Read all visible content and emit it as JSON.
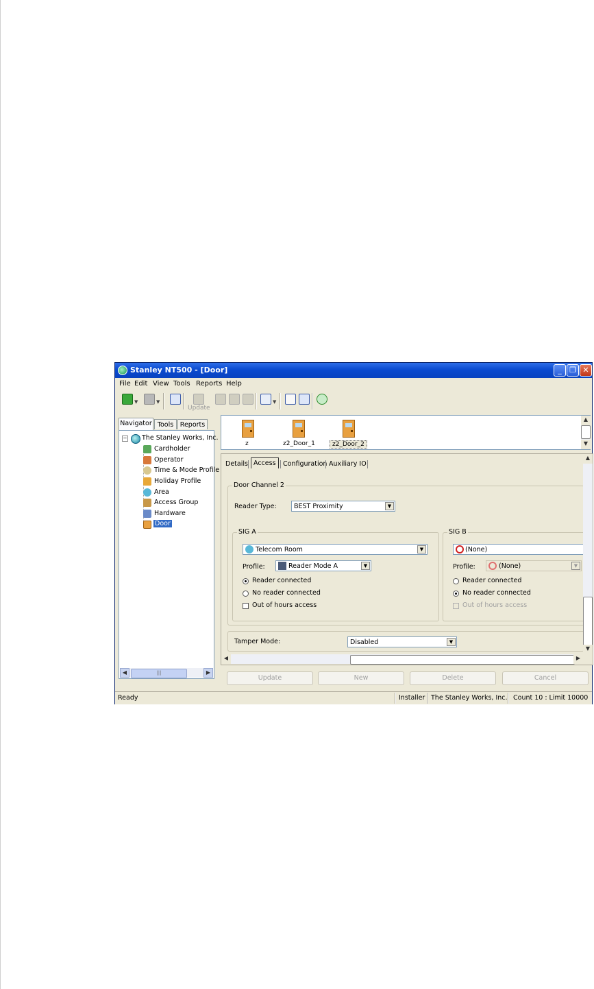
{
  "window": {
    "title": "Stanley NT500 - [Door]",
    "controls": [
      "minimize",
      "maximize",
      "close"
    ]
  },
  "menu": [
    "File",
    "Edit",
    "View",
    "Tools",
    "Reports",
    "Help"
  ],
  "toolbar": {
    "update_label": "Update"
  },
  "nav_tabs": [
    "Navigator",
    "Tools",
    "Reports"
  ],
  "tree": {
    "root": "The Stanley Works, Inc.",
    "items": [
      "Cardholder",
      "Operator",
      "Time & Mode Profile",
      "Holiday Profile",
      "Area",
      "Access Group",
      "Hardware",
      "Door"
    ],
    "selected": "Door"
  },
  "doors": [
    "z",
    "z2_Door_1",
    "z2_Door_2"
  ],
  "tabs": [
    "Details",
    "Access",
    "Configuration",
    "Auxiliary IO"
  ],
  "active_tab": "Access",
  "form": {
    "channel_title": "Door Channel 2",
    "reader_type_label": "Reader Type:",
    "reader_type_value": "BEST Proximity",
    "sig_a": {
      "title": "SIG A",
      "area_value": "Telecom Room",
      "profile_label": "Profile:",
      "profile_value": "Reader Mode A",
      "reader_connected": "Reader connected",
      "no_reader_connected": "No reader connected",
      "out_of_hours": "Out of hours access",
      "selected_radio": "reader_connected"
    },
    "sig_b": {
      "title": "SIG B",
      "area_value": "(None)",
      "profile_label": "Profile:",
      "profile_value": "(None)",
      "reader_connected": "Reader connected",
      "no_reader_connected": "No reader connected",
      "out_of_hours": "Out of hours access",
      "selected_radio": "no_reader_connected"
    },
    "tamper_label": "Tamper Mode:",
    "tamper_value": "Disabled"
  },
  "actions": [
    "Update",
    "New",
    "Delete",
    "Cancel"
  ],
  "status": {
    "left": "Ready",
    "user": "Installer",
    "company": "The Stanley Works, Inc.",
    "count": "Count 10 : Limit 10000"
  },
  "colors": {
    "titlebar": "#0a4ad0",
    "window_bg": "#ece9d8",
    "selection": "#316ac5"
  }
}
